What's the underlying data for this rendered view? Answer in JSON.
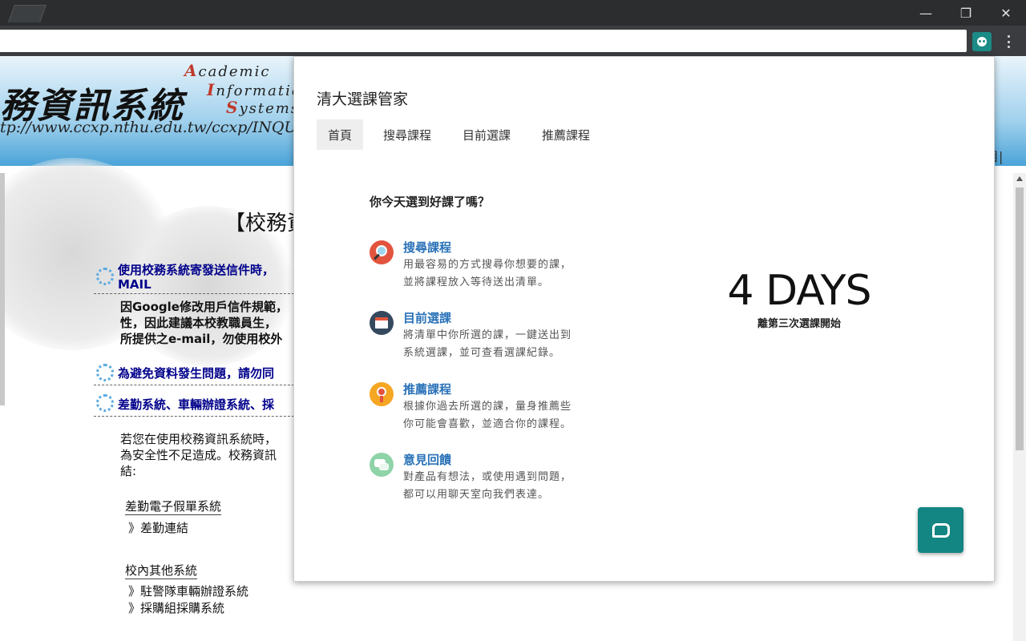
{
  "browser": {
    "window_controls": {
      "minimize": "—",
      "restore": "❐",
      "close": "✕"
    }
  },
  "background_page": {
    "banner": {
      "title_cn": "務資訊系統",
      "title_en_lines": [
        {
          "cap": "A",
          "rest": "cademic"
        },
        {
          "cap": "I",
          "rest": "nformatic"
        },
        {
          "cap": "S",
          "rest": "ystems"
        }
      ],
      "url": "tp://www.ccxp.nthu.edu.tw/ccxp/INQUIR",
      "right_text": "目|"
    },
    "heading": "【校務資",
    "links": [
      {
        "line1": "使用校務系統寄發送信件時，",
        "line2": "MAIL"
      },
      {
        "line1": "為避免資料發生問題，請勿同"
      },
      {
        "line1": "差勤系統、車輛辦證系統、採"
      }
    ],
    "paragraph1": [
      "因Google修改用戶信件規範，",
      "性，因此建議本校教職員生，",
      "所提供之e-mail，勿使用校外"
    ],
    "paragraph2": [
      "若您在使用校務資訊系統時，",
      "為安全性不足造成。校務資訊",
      "結:"
    ],
    "section1": {
      "title": "差勤電子假單系統",
      "items": [
        "》差勤連結"
      ]
    },
    "section2": {
      "title": "校內其他系統",
      "items": [
        "》駐警隊車輛辦證系統",
        "》採購組採購系統"
      ]
    }
  },
  "popup": {
    "title": "清大選課管家",
    "tabs": [
      {
        "label": "首頁",
        "active": true
      },
      {
        "label": "搜尋課程",
        "active": false
      },
      {
        "label": "目前選課",
        "active": false
      },
      {
        "label": "推薦課程",
        "active": false
      }
    ],
    "question": "你今天選到好課了嗎？",
    "features": [
      {
        "title": "搜尋課程",
        "desc": [
          "用最容易的方式搜尋你想要的課，",
          "並將課程放入等待送出清單。"
        ],
        "icon": "search-icon",
        "color": "#e2543e"
      },
      {
        "title": "目前選課",
        "desc": [
          "將清單中你所選的課，一鍵送出到",
          "系統選課，並可查看選課紀錄。"
        ],
        "icon": "calendar-icon",
        "color": "#34495e"
      },
      {
        "title": "推薦課程",
        "desc": [
          "根據你過去所選的課，量身推薦些",
          "你可能會喜歡，並適合你的課程。"
        ],
        "icon": "medal-icon",
        "color": "#f5a623"
      },
      {
        "title": "意見回饋",
        "desc": [
          "對產品有想法，或使用遇到問題，",
          "都可以用聊天室向我們表達。"
        ],
        "icon": "chat-bubbles-icon",
        "color": "#8fd3a8"
      }
    ],
    "countdown": {
      "value": "4 DAYS",
      "caption": "離第三次選課開始"
    },
    "chat_button_icon": "chat-icon"
  }
}
